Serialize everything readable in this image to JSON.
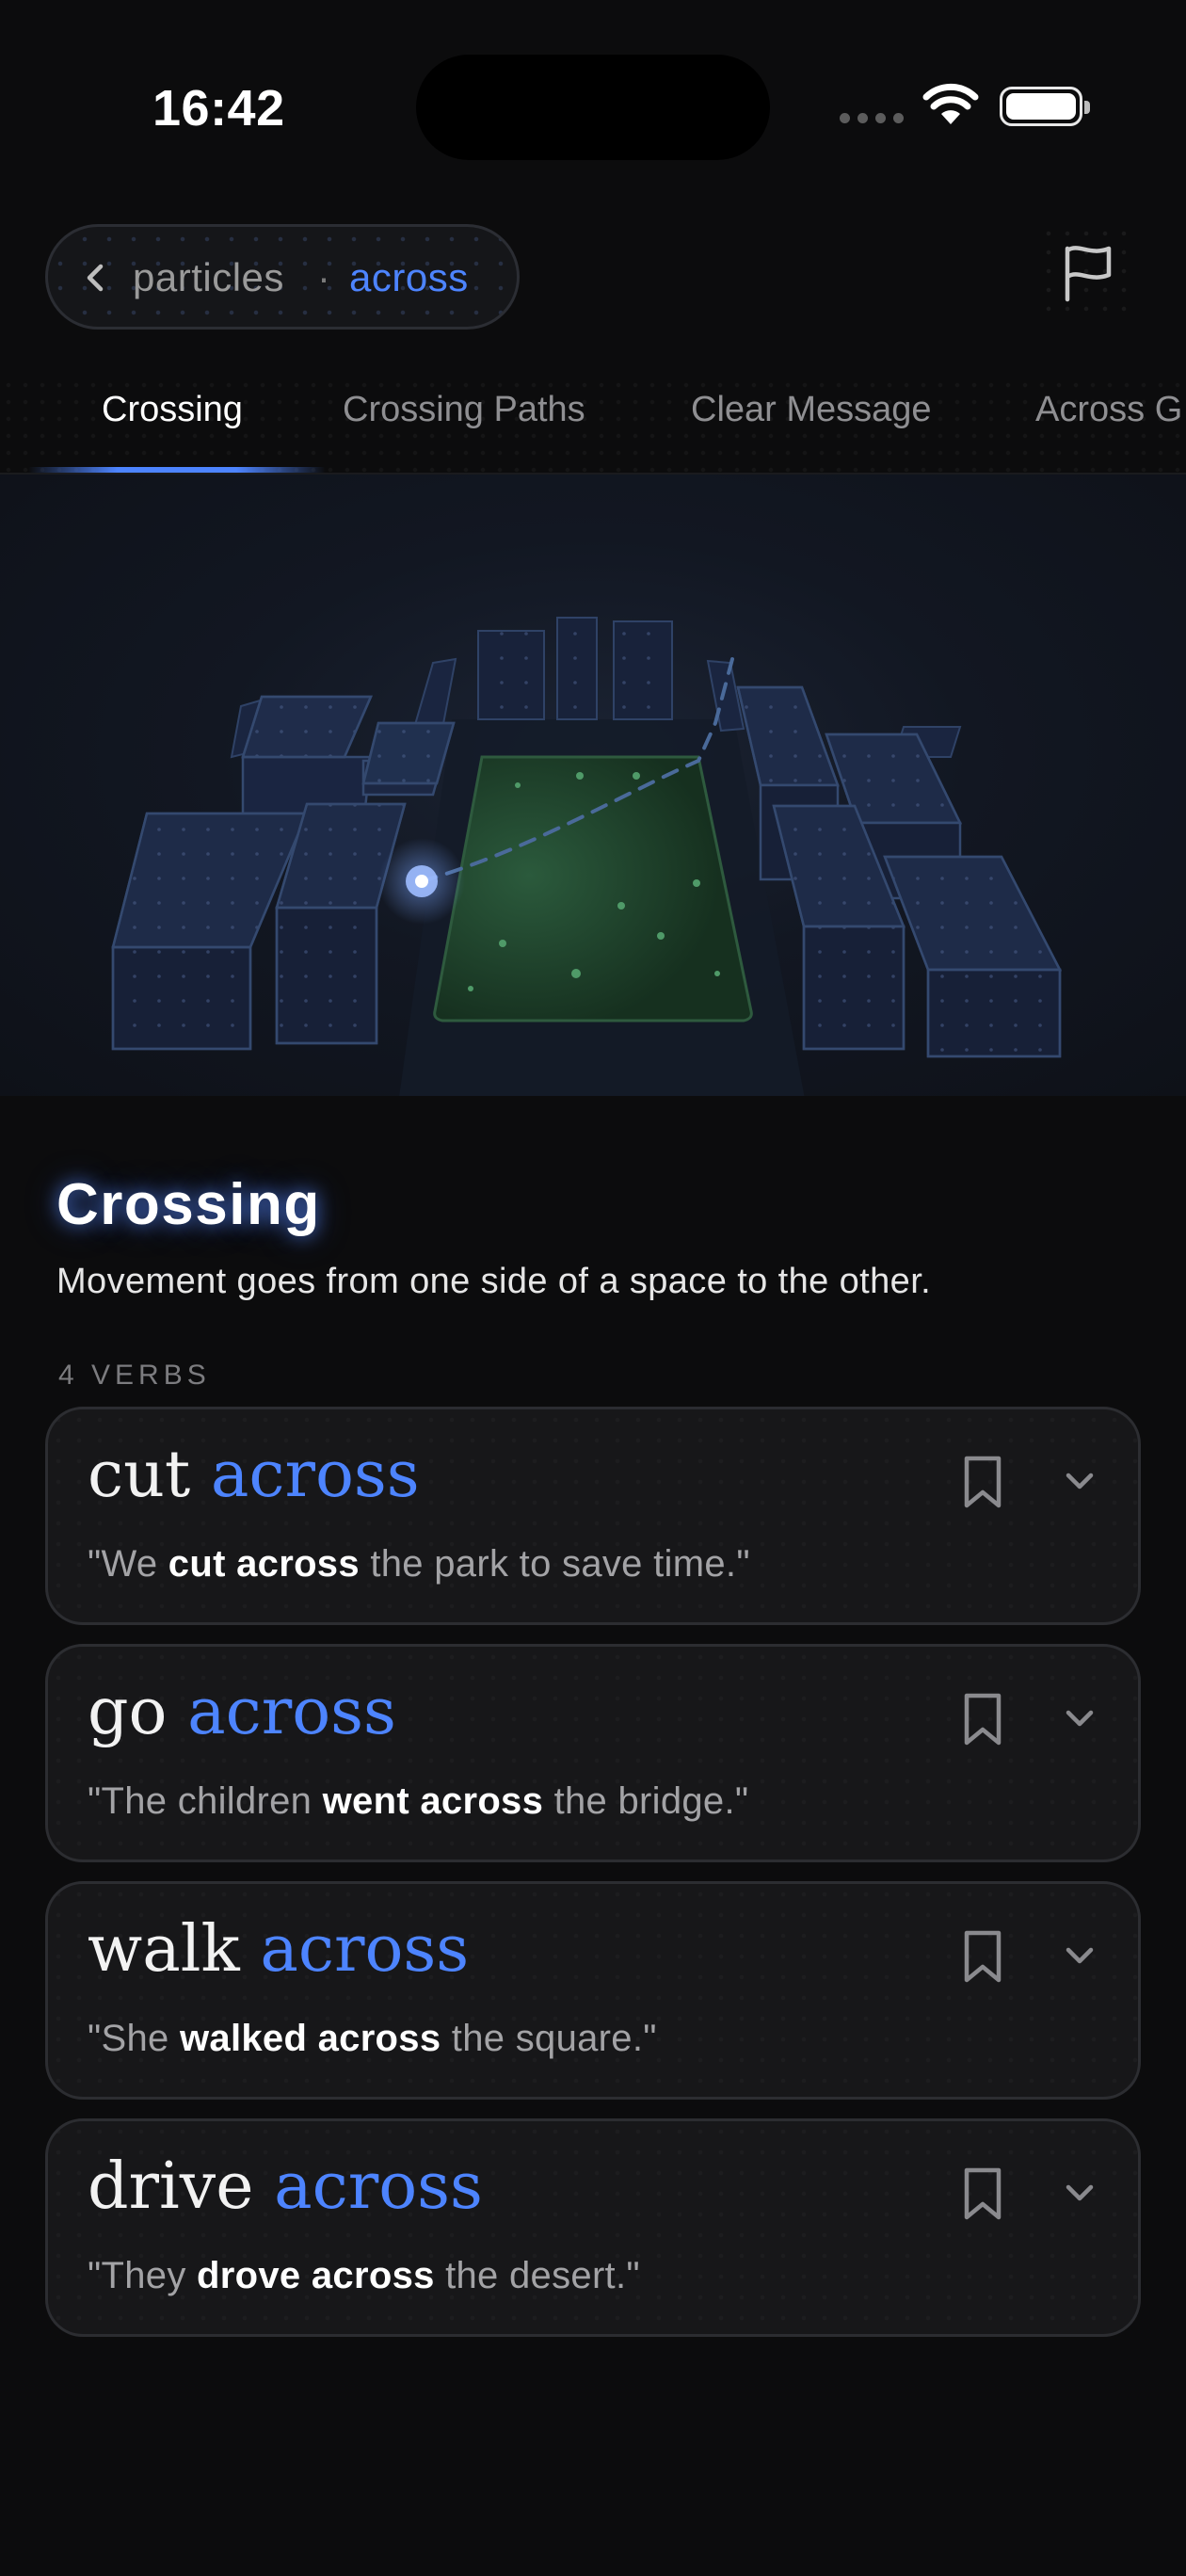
{
  "status_bar": {
    "time": "16:42"
  },
  "breadcrumb": {
    "parent": "particles",
    "separator": "·",
    "current": "across"
  },
  "tabs": [
    {
      "label": "Crossing",
      "active": true
    },
    {
      "label": "Crossing Paths",
      "active": false
    },
    {
      "label": "Clear Message",
      "active": false
    },
    {
      "label": "Across G",
      "active": false
    }
  ],
  "section": {
    "title": "Crossing",
    "description": "Movement goes from one side of a space to the other.",
    "count_label": "4 VERBS"
  },
  "verbs": [
    {
      "verb": "cut",
      "particle": "across",
      "example_pre": "\"We ",
      "example_bold": "cut across",
      "example_post": " the park to save time.\""
    },
    {
      "verb": "go",
      "particle": "across",
      "example_pre": "\"The children ",
      "example_bold": "went across",
      "example_post": " the bridge.\""
    },
    {
      "verb": "walk",
      "particle": "across",
      "example_pre": "\"She ",
      "example_bold": "walked across",
      "example_post": " the square.\""
    },
    {
      "verb": "drive",
      "particle": "across",
      "example_pre": "\"They ",
      "example_bold": "drove across",
      "example_post": " the desert.\""
    }
  ],
  "icons": {
    "back": "chevron-left-icon",
    "report": "flag-icon",
    "save": "bookmark-icon",
    "expand": "chevron-down-icon"
  },
  "colors": {
    "background": "#0c0c0d",
    "accent": "#4d84ff",
    "card": "#171719",
    "park": "#1a3524"
  }
}
